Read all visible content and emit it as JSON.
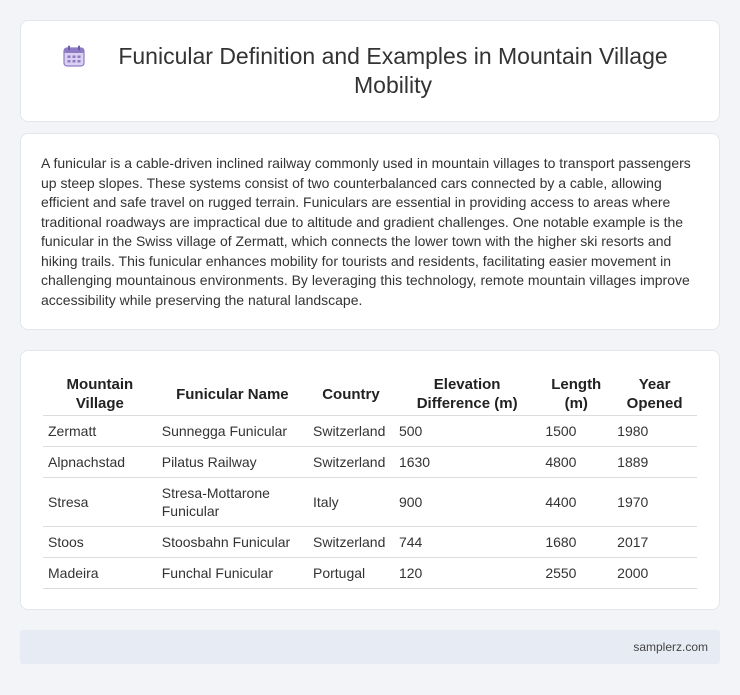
{
  "header": {
    "title": "Funicular Definition and Examples in Mountain Village Mobility",
    "icon": "calendar-icon"
  },
  "summary": "A funicular is a cable-driven inclined railway commonly used in mountain villages to transport passengers up steep slopes. These systems consist of two counterbalanced cars connected by a cable, allowing efficient and safe travel on rugged terrain. Funiculars are essential in providing access to areas where traditional roadways are impractical due to altitude and gradient challenges. One notable example is the funicular in the Swiss village of Zermatt, which connects the lower town with the higher ski resorts and hiking trails. This funicular enhances mobility for tourists and residents, facilitating easier movement in challenging mountainous environments. By leveraging this technology, remote mountain villages improve accessibility while preserving the natural landscape.",
  "table": {
    "headers": [
      "Mountain Village",
      "Funicular Name",
      "Country",
      "Elevation Difference (m)",
      "Length (m)",
      "Year Opened"
    ],
    "rows": [
      [
        "Zermatt",
        "Sunnegga Funicular",
        "Switzerland",
        "500",
        "1500",
        "1980"
      ],
      [
        "Alpnachstad",
        "Pilatus Railway",
        "Switzerland",
        "1630",
        "4800",
        "1889"
      ],
      [
        "Stresa",
        "Stresa-Mottarone Funicular",
        "Italy",
        "900",
        "4400",
        "1970"
      ],
      [
        "Stoos",
        "Stoosbahn Funicular",
        "Switzerland",
        "744",
        "1680",
        "2017"
      ],
      [
        "Madeira",
        "Funchal Funicular",
        "Portugal",
        "120",
        "2550",
        "2000"
      ]
    ]
  },
  "footer": {
    "site": "samplerz.com"
  },
  "colors": {
    "accent": "#8e7cc3",
    "background": "#f2f4f7",
    "footer_bg": "#e7ecf4"
  }
}
